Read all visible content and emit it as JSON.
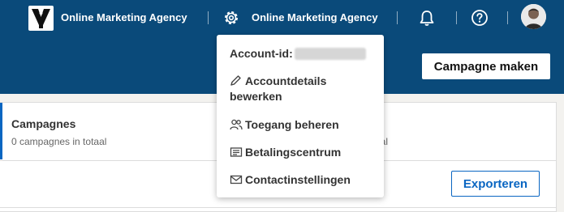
{
  "topbar": {
    "org_name": "Online Marketing Agency",
    "account_name": "Online Marketing Agency"
  },
  "banner": {
    "create_button": "Campagne maken"
  },
  "panel": {
    "campaigns_title": "Campagnes",
    "campaigns_count": "0 campagnes in totaal",
    "partial_total": "aal",
    "export_button": "Exporteren"
  },
  "menu": {
    "account_id_label": "Account-id:",
    "items": [
      {
        "label": "Accountdetails bewerken",
        "icon": "pencil-icon"
      },
      {
        "label": "Toegang beheren",
        "icon": "people-icon"
      },
      {
        "label": "Betalingscentrum",
        "icon": "billing-icon"
      },
      {
        "label": "Contactinstellingen",
        "icon": "envelope-icon"
      }
    ]
  },
  "colors": {
    "header_blue": "#0a4a7a",
    "accent_blue": "#0a66c2"
  }
}
